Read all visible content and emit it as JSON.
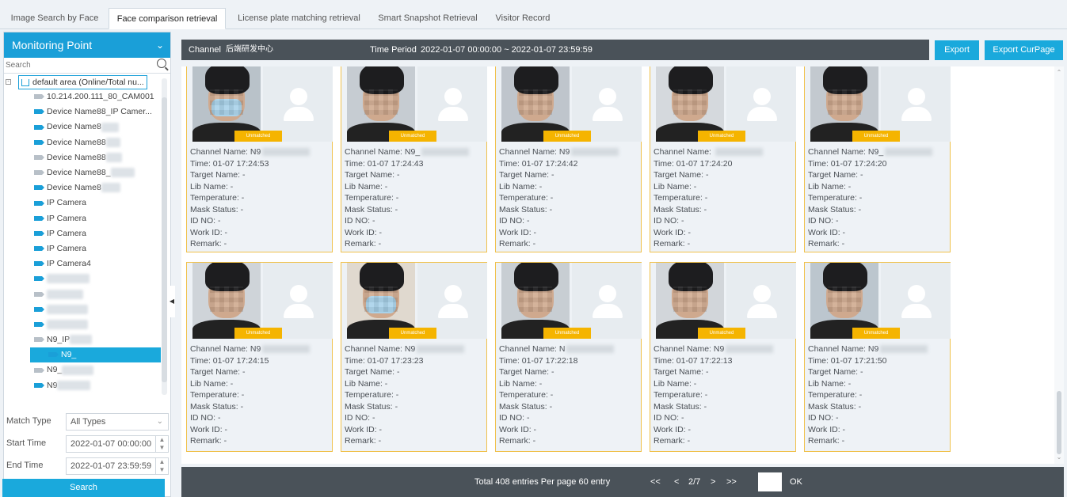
{
  "tabs": [
    {
      "label": "Image Search by Face"
    },
    {
      "label": "Face comparison retrieval"
    },
    {
      "label": "License plate matching retrieval"
    },
    {
      "label": "Smart Snapshot Retrieval"
    },
    {
      "label": "Visitor Record"
    }
  ],
  "active_tab": "Face comparison retrieval",
  "sidebar": {
    "title": "Monitoring Point",
    "search_placeholder": "Search",
    "root": "default area (Online/Total nu...",
    "items": [
      {
        "label": "10.214.200.111_80_CAM001",
        "icon": "camera-offline-icon"
      },
      {
        "label": "Device Name88_IP Camer...",
        "icon": "camera-online-icon"
      },
      {
        "label": "Device Name8",
        "icon": "camera-online-icon"
      },
      {
        "label": "Device Name88",
        "icon": "camera-online-icon"
      },
      {
        "label": "Device Name88",
        "icon": "camera-offline-icon"
      },
      {
        "label": "Device Name88_",
        "icon": "camera-offline-icon"
      },
      {
        "label": "Device Name8",
        "icon": "camera-online-icon"
      },
      {
        "label": "IP Camera",
        "icon": "camera-online-icon"
      },
      {
        "label": "IP Camera",
        "icon": "camera-online-icon"
      },
      {
        "label": "IP Camera",
        "icon": "camera-online-icon"
      },
      {
        "label": "IP Camera",
        "icon": "camera-online-icon"
      },
      {
        "label": "IP Camera4",
        "icon": "camera-online-icon"
      },
      {
        "label": "",
        "icon": "camera-online-icon"
      },
      {
        "label": "",
        "icon": "camera-offline-icon"
      },
      {
        "label": "",
        "icon": "camera-online-icon"
      },
      {
        "label": "",
        "icon": "camera-online-icon"
      },
      {
        "label": "N9_IP",
        "icon": "camera-offline-icon"
      },
      {
        "label": "N9_",
        "icon": "camera-online-icon"
      },
      {
        "label": "N9_",
        "icon": "camera-offline-icon"
      },
      {
        "label": "N9",
        "icon": "camera-online-icon"
      }
    ],
    "match_type_label": "Match Type",
    "match_type_value": "All Types",
    "start_time_label": "Start Time",
    "start_time_value": "2022-01-07 00:00:00",
    "end_time_label": "End Time",
    "end_time_value": "2022-01-07 23:59:59",
    "search_button": "Search"
  },
  "topbar": {
    "channel_label": "Channel",
    "channel_value": "后端研发中心",
    "time_period_label": "Time Period",
    "time_period_value": "2022-01-07 00:00:00 ~ 2022-01-07 23:59:59",
    "export_button": "Export",
    "export_curpage_button": "Export CurPage"
  },
  "card_fields": {
    "channel": "Channel Name:",
    "time": "Time:",
    "target": "Target Name: -",
    "lib": "Lib Name: -",
    "temperature": "Temperature: -",
    "mask": "Mask Status: -",
    "id": "ID NO: -",
    "work": "Work ID: -",
    "remark": "Remark: -",
    "tag": "Unmatched"
  },
  "cards": [
    {
      "channel": "N9",
      "time": "01-07 17:24:53",
      "mask": true
    },
    {
      "channel": "N9_",
      "time": "01-07 17:24:43",
      "mask": false
    },
    {
      "channel": "N9",
      "time": "01-07 17:24:42",
      "mask": false
    },
    {
      "channel": "",
      "time": "01-07 17:24:20",
      "mask": false
    },
    {
      "channel": "N9_",
      "time": "01-07 17:24:20",
      "mask": false
    },
    {
      "channel": "N9",
      "time": "01-07 17:24:15",
      "mask": false
    },
    {
      "channel": "N9",
      "time": "01-07 17:23:23",
      "mask": true
    },
    {
      "channel": "N",
      "time": "01-07 17:22:18",
      "mask": false
    },
    {
      "channel": "N9",
      "time": "01-07 17:22:13",
      "mask": false
    },
    {
      "channel": "N9",
      "time": "01-07 17:21:50",
      "mask": false
    }
  ],
  "pager": {
    "summary": "Total 408 entries  Per page 60 entry",
    "first": "<<",
    "prev": "<",
    "page": "2/7",
    "next": ">",
    "last": ">>",
    "ok": "OK"
  }
}
